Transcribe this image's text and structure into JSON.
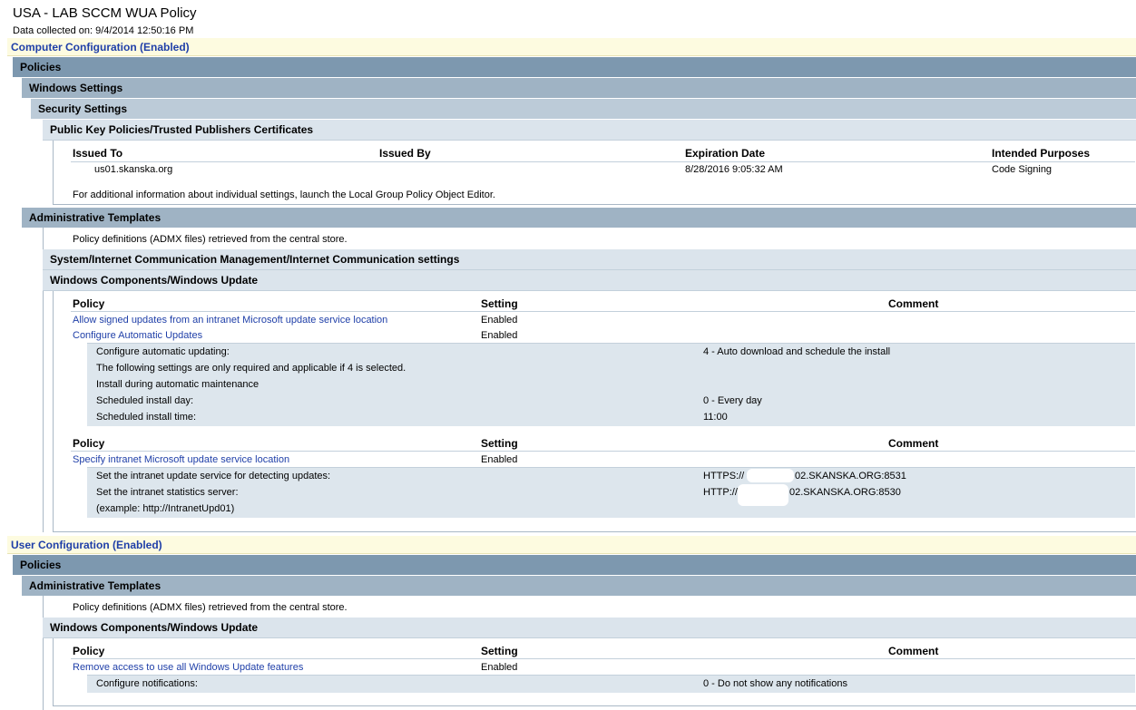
{
  "header": {
    "title": "USA - LAB SCCM WUA Policy",
    "collected": "Data collected on: 9/4/2014 12:50:16 PM"
  },
  "computer": {
    "label": "Computer Configuration (Enabled)",
    "policies": "Policies",
    "windows_settings": "Windows Settings",
    "security_settings": "Security Settings",
    "pkp": "Public Key Policies/Trusted Publishers Certificates",
    "cert_headers": [
      "Issued To",
      "Issued By",
      "Expiration Date",
      "Intended Purposes"
    ],
    "cert_row": {
      "issued_to": "us01.skanska.org",
      "issued_by": "",
      "expiration": "8/28/2016 9:05:32 AM",
      "purpose": "Code Signing"
    },
    "cert_note": "For additional information about individual settings, launch the Local Group Policy Object Editor.",
    "admin_templates": "Administrative Templates",
    "admx_note": "Policy definitions (ADMX files) retrieved from the central store.",
    "internet_comm": "System/Internet Communication Management/Internet Communication settings",
    "wu": "Windows Components/Windows Update",
    "policy_headers": [
      "Policy",
      "Setting",
      "Comment"
    ],
    "p1": {
      "name": "Allow signed updates from an intranet Microsoft update service location",
      "setting": "Enabled"
    },
    "p2": {
      "name": "Configure Automatic Updates",
      "setting": "Enabled"
    },
    "p2_details": [
      {
        "label": "Configure automatic updating:",
        "value": "4 - Auto download and schedule the install"
      },
      {
        "label": "The following settings are only required and applicable if 4 is selected.",
        "value": ""
      },
      {
        "label": "Install during automatic maintenance",
        "value": ""
      },
      {
        "label": "Scheduled install day:",
        "value": "0 - Every day"
      },
      {
        "label": "Scheduled install time:",
        "value": "11:00"
      }
    ],
    "p3": {
      "name": "Specify intranet Microsoft update service location",
      "setting": "Enabled"
    },
    "p3_details": [
      {
        "label": "Set the intranet update service for detecting updates:",
        "value_a": "HTTPS://",
        "value_b": "02.SKANSKA.ORG:8531"
      },
      {
        "label": "Set the intranet statistics server:",
        "value_a": "HTTP://",
        "value_b": "02.SKANSKA.ORG:8530"
      },
      {
        "label": "(example: http://IntranetUpd01)",
        "value_a": "",
        "value_b": ""
      }
    ]
  },
  "user": {
    "label": "User Configuration (Enabled)",
    "policies": "Policies",
    "admin_templates": "Administrative Templates",
    "admx_note": "Policy definitions (ADMX files) retrieved from the central store.",
    "wu": "Windows Components/Windows Update",
    "policy_headers": [
      "Policy",
      "Setting",
      "Comment"
    ],
    "p1": {
      "name": "Remove access to use all Windows Update features",
      "setting": "Enabled"
    },
    "p1_details": [
      {
        "label": "Configure notifications:",
        "value": "0 - Do not show any notifications"
      }
    ]
  },
  "colors": {
    "link": "#1f3fa8",
    "config_bar": "#fdfbe0",
    "level1": "#7d98af",
    "level2": "#9fb3c4",
    "level3": "#bccbd8",
    "level4": "#dbe4ec"
  }
}
